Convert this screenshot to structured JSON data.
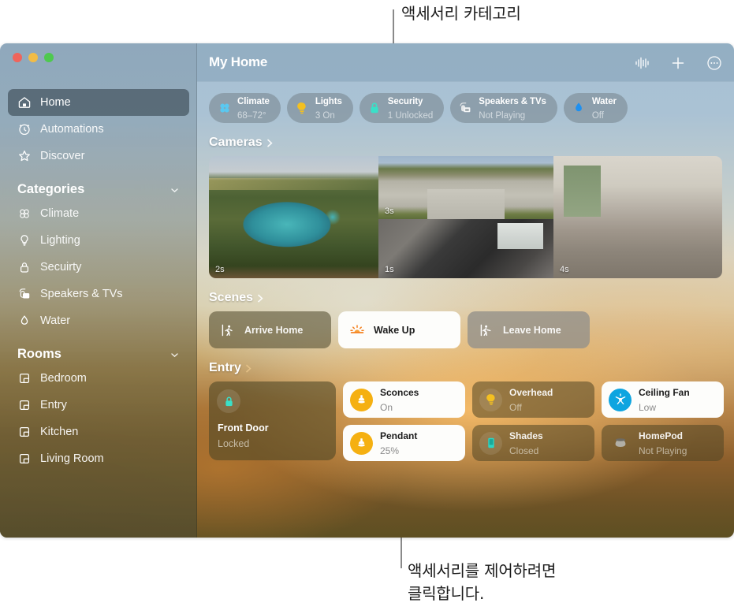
{
  "annotations": {
    "top": "액세서리 카테고리",
    "bottom_line1": "액세서리를 제어하려면",
    "bottom_line2": "클릭합니다."
  },
  "window": {
    "traffic_lights": [
      "close",
      "minimize",
      "zoom"
    ]
  },
  "sidebar": {
    "nav": [
      {
        "label": "Home",
        "icon": "house-icon",
        "selected": true
      },
      {
        "label": "Automations",
        "icon": "automation-clock-icon",
        "selected": false
      },
      {
        "label": "Discover",
        "icon": "star-icon",
        "selected": false
      }
    ],
    "categories_header": "Categories",
    "categories": [
      {
        "label": "Climate",
        "icon": "fan-icon"
      },
      {
        "label": "Lighting",
        "icon": "bulb-icon"
      },
      {
        "label": "Secuirty",
        "icon": "lock-icon"
      },
      {
        "label": "Speakers & TVs",
        "icon": "speaker-tv-icon"
      },
      {
        "label": "Water",
        "icon": "water-drop-icon"
      }
    ],
    "rooms_header": "Rooms",
    "rooms": [
      {
        "label": "Bedroom",
        "icon": "room-icon"
      },
      {
        "label": "Entry",
        "icon": "room-icon"
      },
      {
        "label": "Kitchen",
        "icon": "room-icon"
      },
      {
        "label": "Living Room",
        "icon": "room-icon"
      }
    ]
  },
  "header": {
    "title": "My Home",
    "actions": [
      {
        "name": "siri-waveform-icon",
        "label": "Siri"
      },
      {
        "name": "plus-icon",
        "label": "Add"
      },
      {
        "name": "more-options-icon",
        "label": "More"
      }
    ]
  },
  "pills": [
    {
      "name": "Climate",
      "status": "68–72°",
      "icon": "fan-icon",
      "color": "#5ac8f0"
    },
    {
      "name": "Lights",
      "status": "3 On",
      "icon": "bulb-icon",
      "color": "#f4c020"
    },
    {
      "name": "Security",
      "status": "1 Unlocked",
      "icon": "lock-icon",
      "color": "#3ae0c8"
    },
    {
      "name": "Speakers & TVs",
      "status": "Not Playing",
      "icon": "speaker-tv-icon",
      "color": "#e3e6e8"
    },
    {
      "name": "Water",
      "status": "Off",
      "icon": "water-drop-icon",
      "color": "#1e90f0"
    }
  ],
  "sections": {
    "cameras": "Cameras",
    "scenes": "Scenes",
    "entry": "Entry"
  },
  "cameras": [
    {
      "label": "2s",
      "view": "pool"
    },
    {
      "label": "3s",
      "view": "street"
    },
    {
      "label": "1s",
      "view": "garage"
    },
    {
      "label": "4s",
      "view": "living-room"
    }
  ],
  "scenes": [
    {
      "label": "Arrive Home",
      "icon": "walk-in-icon",
      "state": "dark"
    },
    {
      "label": "Wake Up",
      "icon": "sunrise-icon",
      "state": "light"
    },
    {
      "label": "Leave Home",
      "icon": "walk-out-icon",
      "state": "grey"
    }
  ],
  "entry": {
    "front_door": {
      "name": "Front Door",
      "status": "Locked",
      "icon": "lock-icon",
      "color": "#3ae0c8"
    },
    "accessories": [
      {
        "name": "Sconces",
        "status": "On",
        "icon": "sconce-light-icon",
        "state": "on"
      },
      {
        "name": "Pendant",
        "status": "25%",
        "icon": "pendant-light-icon",
        "state": "on"
      },
      {
        "name": "Overhead",
        "status": "Off",
        "icon": "bulb-icon",
        "state": "off"
      },
      {
        "name": "Shades",
        "status": "Closed",
        "icon": "shade-icon",
        "state": "off"
      },
      {
        "name": "Ceiling Fan",
        "status": "Low",
        "icon": "ceiling-fan-icon",
        "state": "on"
      },
      {
        "name": "HomePod",
        "status": "Not Playing",
        "icon": "homepod-icon",
        "state": "off"
      }
    ]
  },
  "colors": {
    "accent_yellow": "#f5b011",
    "accent_blue": "#0ea5e0",
    "accent_teal": "#3ae0c8",
    "titlebar": "#84a0b6"
  }
}
